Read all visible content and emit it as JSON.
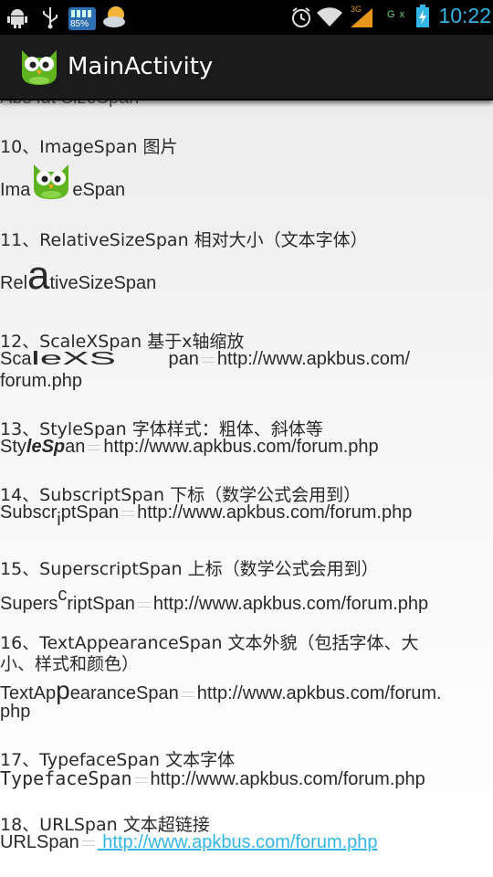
{
  "status_bar": {
    "battery_badge": "85%",
    "time": "10:22",
    "network_label": "3G",
    "signal_label": "G"
  },
  "app_bar": {
    "title": "MainActivity"
  },
  "content": {
    "partial_top": "Abs   lut   SizeSpan",
    "item10": {
      "heading": "10、ImageSpan 图片",
      "demo_before": "Ima",
      "demo_after": "eSpan"
    },
    "item11": {
      "heading": "11、RelativeSizeSpan 相对大小（文本字体）",
      "demo_a": "Rel",
      "demo_big": "a",
      "demo_b": "tiveSizeSpan"
    },
    "item12": {
      "heading": "12、ScaleXSpan 基于x轴缩放",
      "demo_a": "Sca",
      "demo_scaled": "leXS",
      "demo_b": "pan",
      "url_a": "http://www.apkbus.com/",
      "url_b": "forum.php"
    },
    "item13": {
      "heading": "13、StyleSpan 字体样式：粗体、斜体等",
      "demo_a": "Sty",
      "demo_styled": "leSp",
      "demo_b": "an",
      "url": "http://www.apkbus.com/forum.php"
    },
    "item14": {
      "heading": "14、SubscriptSpan 下标（数学公式会用到）",
      "demo_a": "Subscr",
      "demo_sub": "i",
      "demo_b": "ptSpan",
      "url": "http://www.apkbus.com/forum.php"
    },
    "item15": {
      "heading": "15、SuperscriptSpan 上标（数学公式会用到）",
      "demo_a": "Supers",
      "demo_sup": "c",
      "demo_b": "riptSpan",
      "url": "http://www.apkbus.com/forum.php"
    },
    "item16": {
      "heading_a": "16、TextAppearanceSpan 文本外貌（包括字体、大",
      "heading_b": "小、样式和颜色）",
      "demo_a": "TextAp",
      "demo_big": "p",
      "demo_b": "earanceSpan",
      "url_a": "http://www.apkbus.com/forum.",
      "url_b": "php"
    },
    "item17": {
      "heading": "17、TypefaceSpan 文本字体",
      "demo": "TypefaceSpan",
      "url": "http://www.apkbus.com/forum.php"
    },
    "item18": {
      "heading": "18、URLSpan 文本超链接",
      "demo": "URLSpan",
      "link": " http://www.apkbus.com/forum.php"
    }
  },
  "colors": {
    "link": "#33b5e5",
    "clock": "#33b5e5",
    "action_bar": "#1b1b1b",
    "owl_green": "#5fb31e"
  }
}
